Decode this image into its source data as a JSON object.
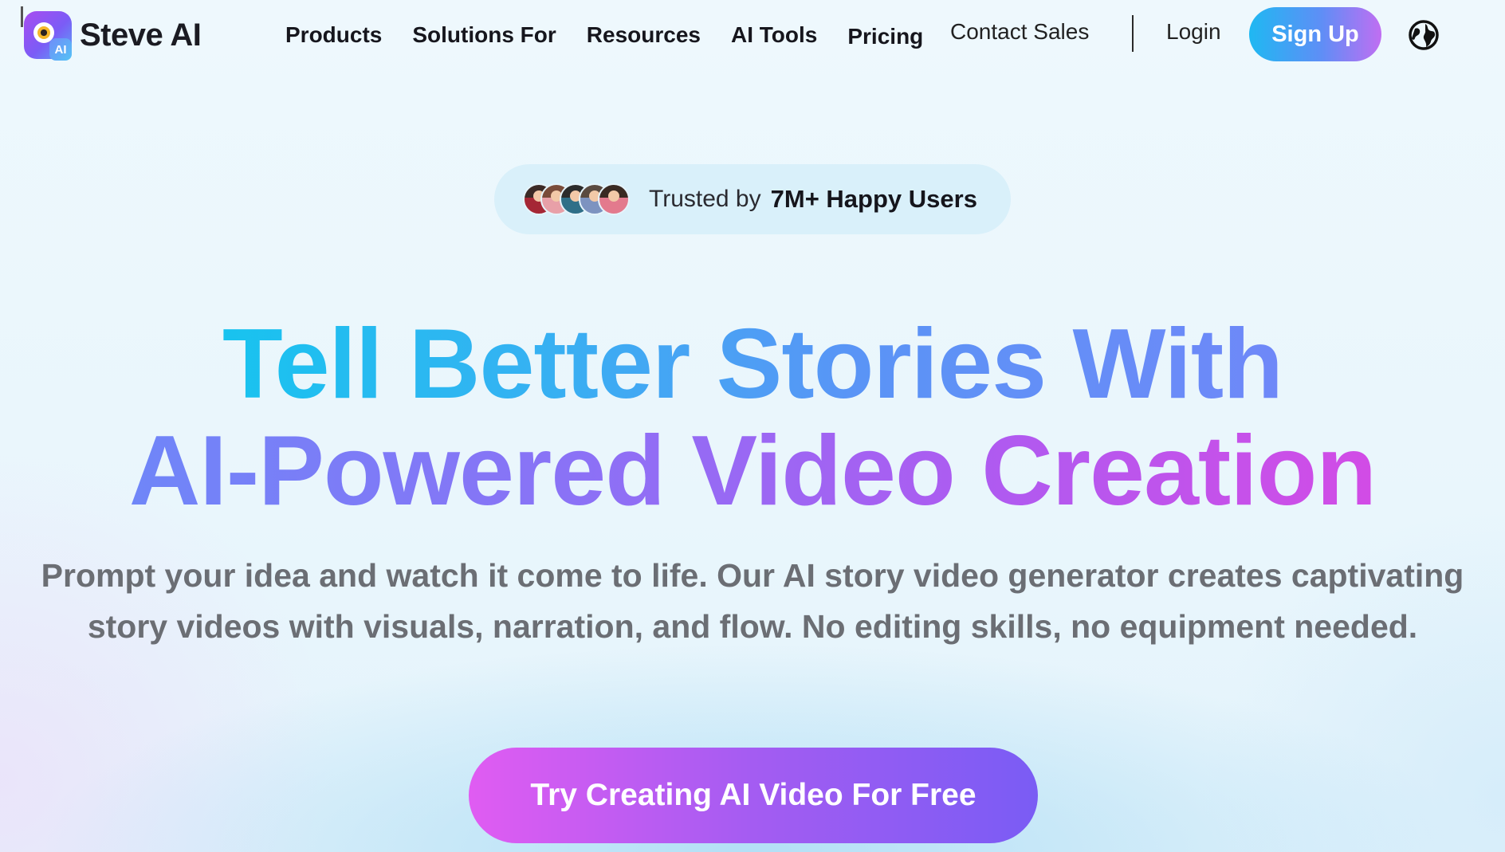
{
  "brand": {
    "name": "Steve AI",
    "badge": "AI"
  },
  "nav": {
    "links": [
      "Products",
      "Solutions For",
      "Resources",
      "AI Tools",
      "Pricing"
    ],
    "contact": "Contact Sales",
    "login": "Login",
    "signup": "Sign Up",
    "globe_icon": "globe-icon"
  },
  "trust": {
    "prefix": "Trusted by",
    "highlight": "7M+ Happy Users"
  },
  "hero": {
    "line1": "Tell Better Stories With",
    "line2": "AI-Powered Video Creation",
    "subtext": "Prompt your idea and watch it come to life. Our AI story video generator creates captivating story videos with visuals, narration, and flow. No editing skills, no equipment needed.",
    "cta": "Try Creating AI Video For Free"
  },
  "colors": {
    "accent_blue": "#1fb8f2",
    "accent_purple": "#a45cf2",
    "accent_pink": "#e05cf2",
    "subtext_gray": "#6b6e74"
  }
}
